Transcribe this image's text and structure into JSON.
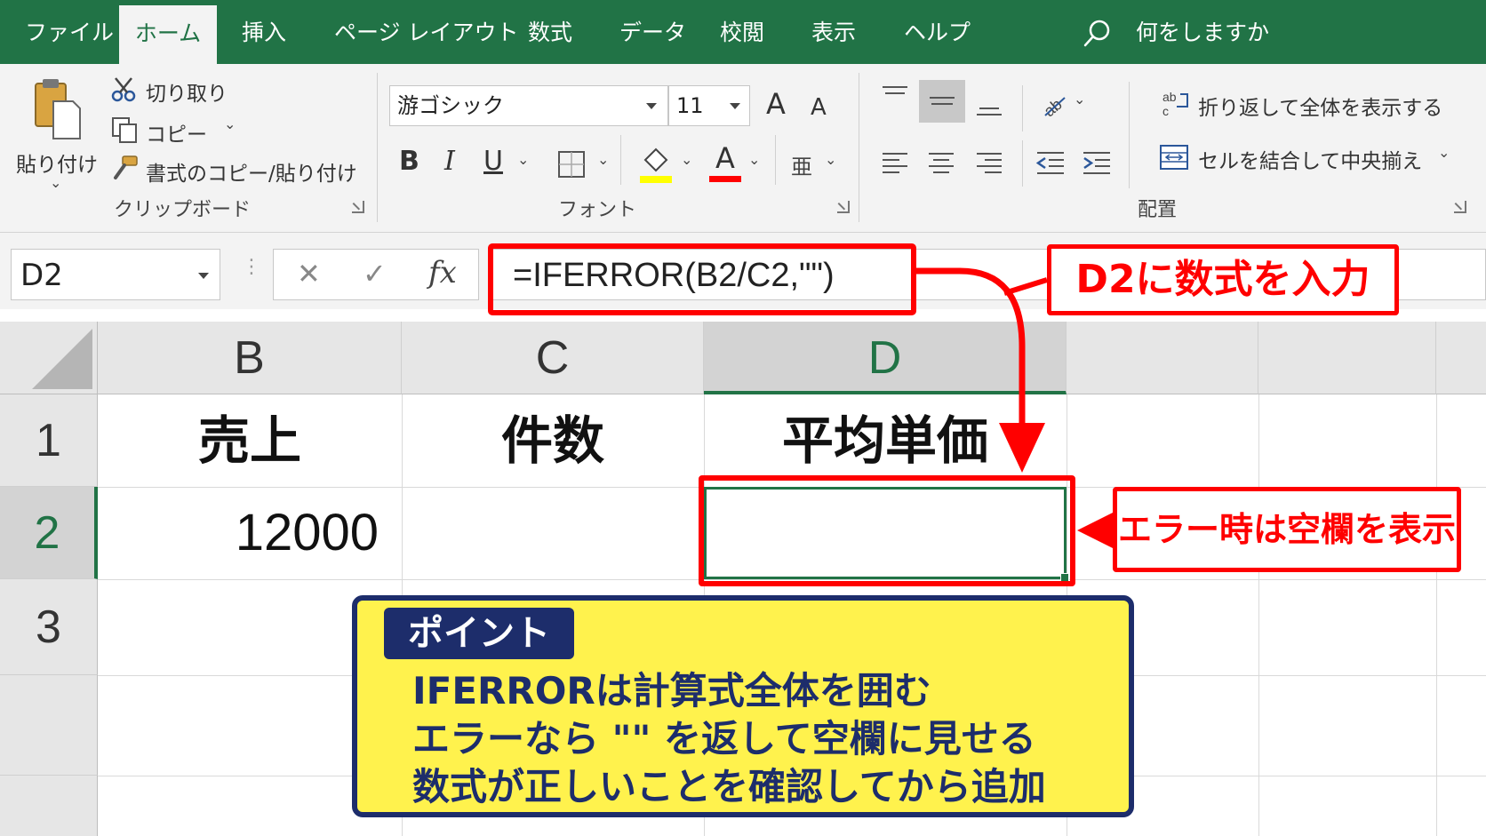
{
  "tabs": [
    {
      "label": "ファイル"
    },
    {
      "label": "ホーム",
      "active": true
    },
    {
      "label": "挿入"
    },
    {
      "label": "ページ レイアウト"
    },
    {
      "label": "数式"
    },
    {
      "label": "データ"
    },
    {
      "label": "校閲"
    },
    {
      "label": "表示"
    },
    {
      "label": "ヘルプ"
    }
  ],
  "search": {
    "icon": "search-icon",
    "text": "何をしますか"
  },
  "clipboard": {
    "paste_label": "貼り付け",
    "cut_label": "切り取り",
    "copy_label": "コピー",
    "format_painter_label": "書式のコピー/貼り付け",
    "group_label": "クリップボード"
  },
  "font": {
    "font_name": "游ゴシック",
    "font_size": "11",
    "grow_label": "A",
    "shrink_label": "A",
    "bold_label": "B",
    "italic_label": "I",
    "underline_label": "U",
    "font_color_label": "A",
    "phonetic_label": "亜",
    "group_label": "フォント",
    "highlight_color": "#ffff00",
    "font_color": "#ff0000"
  },
  "alignment": {
    "wrap_label": "折り返して全体を表示する",
    "merge_label": "セルを結合して中央揃え",
    "group_label": "配置"
  },
  "formula_bar": {
    "name_box": "D2",
    "cancel_label": "✕",
    "enter_label": "✓",
    "fx_label": "fx",
    "formula": "=IFERROR(B2/C2,\"\")"
  },
  "sheet": {
    "columns": [
      "B",
      "C",
      "D"
    ],
    "rows": [
      "1",
      "2",
      "3"
    ],
    "b1": "売上",
    "c1": "件数",
    "d1": "平均単価",
    "b2": "12000",
    "selected_cell": "D2"
  },
  "annotations": {
    "input_callout": "D2に数式を入力",
    "blank_callout": "エラー時は空欄を表示",
    "point_tag": "ポイント",
    "point_lines": [
      "IFERRORは計算式全体を囲む",
      "エラーなら \"\" を返して空欄に見せる",
      "数式が正しいことを確認してから追加"
    ],
    "accent_color": "#ff0000",
    "box_color": "#fff24d",
    "box_border_color": "#1d2d6b"
  },
  "theme": {
    "excel_green": "#217346"
  }
}
